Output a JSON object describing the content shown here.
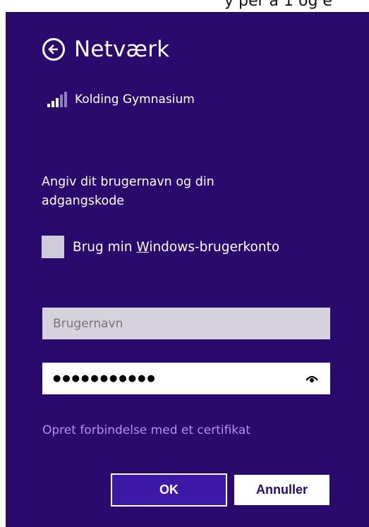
{
  "top_strip_text": "y per a 1 og e",
  "header": {
    "title": "Netværk",
    "back_icon": "back-arrow-circle-icon"
  },
  "network": {
    "name": "Kolding Gymnasium",
    "signal_icon": "wifi-signal-icon",
    "signal_strength": 0.6
  },
  "prompt": "Angiv dit brugernavn og din adgangskode",
  "checkbox": {
    "label_prefix": "Brug min ",
    "label_mnemonic": "W",
    "label_suffix": "indows-brugerkonto",
    "checked": false
  },
  "username": {
    "placeholder": "Brugernavn",
    "value": ""
  },
  "password": {
    "masked_value": "●●●●●●●●●●●",
    "reveal_icon": "reveal-password-icon"
  },
  "cert_link": "Opret forbindelse med et certifikat",
  "buttons": {
    "ok": "OK",
    "cancel": "Annuller"
  },
  "colors": {
    "background": "#2b0a6e",
    "link": "#b38ff0",
    "ok_button": "#3e18a6"
  }
}
